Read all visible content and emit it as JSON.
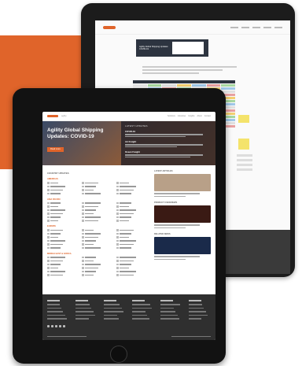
{
  "colors": {
    "accent": "#e0642a",
    "tablet_frame": "#121212",
    "footer_bg": "#2f2f2f",
    "hero_dark": "#2d3440"
  },
  "back_tablet": {
    "hero_text": "Agility Global Shipping Updates: COVID-19",
    "table_rows": 14
  },
  "front_tablet": {
    "nav": {
      "brand": "agility",
      "links": [
        "Solutions",
        "Industries",
        "Insights",
        "About",
        "Contact"
      ]
    },
    "hero": {
      "title": "Agility Global Shipping Updates: COVID-19",
      "button_label": "Read more",
      "latest_label": "LATEST UPDATES",
      "latest_items": [
        "COVID-19",
        "Air Freight",
        "Ocean Freight"
      ]
    },
    "main": {
      "section_title": "COUNTRY UPDATES",
      "regions": [
        {
          "name": "AMERICAS",
          "rows": 4
        },
        {
          "name": "ASIA PACIFIC",
          "rows": 6
        },
        {
          "name": "EUROPE",
          "rows": 6
        },
        {
          "name": "MIDDLE EAST & AFRICA",
          "rows": 6
        }
      ]
    },
    "aside": {
      "cards": [
        {
          "title": "LATEST ARTICLES",
          "color": "#b8a088"
        },
        {
          "title": "PRODUCT OVERVIEWS",
          "color": "#3a1a14"
        },
        {
          "title": "RELATED NEWS",
          "color": "#1a2a4a"
        }
      ]
    },
    "footer": {
      "columns": 6
    }
  }
}
